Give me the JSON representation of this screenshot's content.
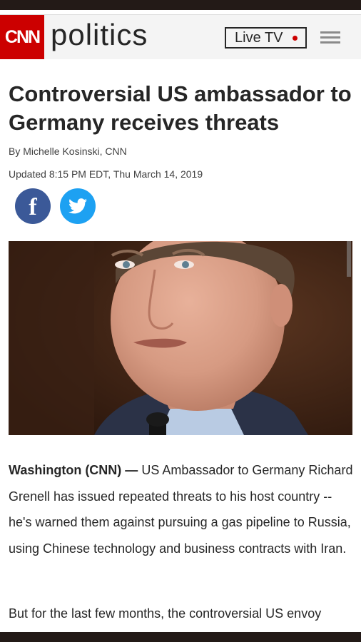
{
  "header": {
    "logo_text": "CNN",
    "section_title": "politics",
    "live_tv_label": "Live TV",
    "menu_icon": "hamburger-menu-icon"
  },
  "article": {
    "headline": "Controversial US ambassador to Germany receives threats",
    "byline": "By Michelle Kosinski, CNN",
    "updated": "Updated 8:15 PM EDT, Thu March 14, 2019",
    "share": {
      "facebook_icon": "facebook-icon",
      "twitter_icon": "twitter-icon"
    },
    "image_caption_visible": "",
    "dateline": "Washington (CNN) —",
    "paragraph_1": "US Ambassador to Germany Richard Grenell has issued repeated threats to his host country -- he's warned them against pursuing a gas pipeline to Russia, using Chinese technology and business contracts with Iran.",
    "paragraph_2": "But for the last few months, the controversial US envoy"
  },
  "colors": {
    "brand_red": "#cc0000",
    "facebook_blue": "#3b5998",
    "twitter_blue": "#1da1f2",
    "text_dark": "#262626"
  }
}
